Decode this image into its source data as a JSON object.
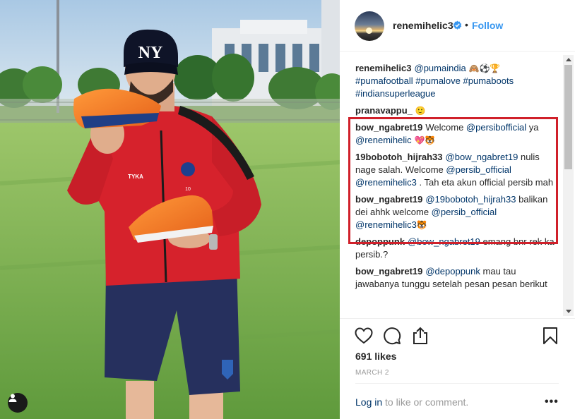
{
  "header": {
    "username": "renemihelic3",
    "separator": "•",
    "follow_label": "Follow"
  },
  "comments": [
    {
      "user": "renemihelic3",
      "parts": [
        {
          "t": "mention",
          "v": "@pumaindia"
        },
        {
          "t": "emoji",
          "v": " 🙈⚽🏆"
        },
        {
          "t": "br"
        },
        {
          "t": "hashtag",
          "v": "#pumafootball"
        },
        {
          "t": "text",
          "v": " "
        },
        {
          "t": "hashtag",
          "v": "#pumalove"
        },
        {
          "t": "text",
          "v": " "
        },
        {
          "t": "hashtag",
          "v": "#pumaboots"
        },
        {
          "t": "br"
        },
        {
          "t": "hashtag",
          "v": "#indiansuperleague"
        }
      ]
    },
    {
      "user": "pranavappu_",
      "parts": [
        {
          "t": "emoji",
          "v": "🙂"
        }
      ]
    },
    {
      "user": "bow_ngabret19",
      "parts": [
        {
          "t": "text",
          "v": "Welcome "
        },
        {
          "t": "mention",
          "v": "@persibofficial"
        },
        {
          "t": "text",
          "v": " ya "
        },
        {
          "t": "mention",
          "v": "@renemihelic"
        },
        {
          "t": "emoji",
          "v": " 💖🐯"
        }
      ]
    },
    {
      "user": "19bobotoh_hijrah33",
      "parts": [
        {
          "t": "mention",
          "v": "@bow_ngabret19"
        },
        {
          "t": "text",
          "v": " nulis nage salah. Welcome "
        },
        {
          "t": "mention",
          "v": "@persib_official"
        },
        {
          "t": "text",
          "v": " "
        },
        {
          "t": "mention",
          "v": "@renemihelic3"
        },
        {
          "t": "text",
          "v": " . Tah eta akun official persib mah"
        }
      ]
    },
    {
      "user": "bow_ngabret19",
      "parts": [
        {
          "t": "mention",
          "v": "@19bobotoh_hijrah33"
        },
        {
          "t": "text",
          "v": " balikan dei ahhk welcome "
        },
        {
          "t": "mention",
          "v": "@persib_official"
        },
        {
          "t": "text",
          "v": " "
        },
        {
          "t": "mention",
          "v": "@renemihelic3"
        },
        {
          "t": "emoji",
          "v": "🐯"
        }
      ]
    },
    {
      "user": "depoppunk",
      "parts": [
        {
          "t": "mention",
          "v": "@bow_ngabret19"
        },
        {
          "t": "text",
          "v": " emang bnr rek ka persib.?"
        }
      ]
    },
    {
      "user": "bow_ngabret19",
      "parts": [
        {
          "t": "mention",
          "v": "@depoppunk"
        },
        {
          "t": "text",
          "v": " mau tau jawabanya tunggu setelah pesan pesan berikut"
        }
      ]
    }
  ],
  "likes": "691 likes",
  "date": "MARCH 2",
  "login": {
    "link_label": "Log in",
    "rest_text": " to like or comment.",
    "more_label": "•••"
  },
  "photo": {
    "cap_logo": "NY",
    "jacket_brand": "TYKA",
    "jacket_number": "10"
  },
  "colors": {
    "link": "#003569",
    "follow": "#3897f0",
    "highlight": "#d0202a",
    "jacket": "#d6222c",
    "shorts": "#26305e",
    "boot": "#f07a1f"
  },
  "icons": [
    "user-tag-icon",
    "verified-badge-icon",
    "heart-icon",
    "comment-icon",
    "share-icon",
    "bookmark-icon"
  ]
}
